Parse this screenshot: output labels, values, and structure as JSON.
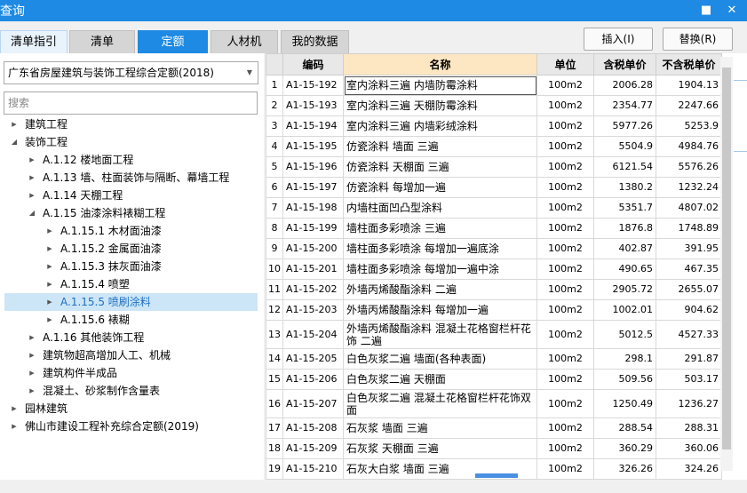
{
  "window": {
    "title": "查询",
    "min_glyph": "■",
    "close_glyph": "✕"
  },
  "tabs": [
    "清单指引",
    "清单",
    "定额",
    "人材机",
    "我的数据"
  ],
  "buttons": {
    "insert": "插入(I)",
    "replace": "替换(R)"
  },
  "combo": {
    "value": "广东省房屋建筑与装饰工程综合定额(2018)"
  },
  "search": {
    "placeholder": "搜索"
  },
  "tree": [
    {
      "label": "建筑工程",
      "state": "collapsed"
    },
    {
      "label": "装饰工程",
      "state": "expanded"
    },
    {
      "label": "A.1.12 楼地面工程",
      "state": "collapsed"
    },
    {
      "label": "A.1.13 墙、柱面装饰与隔断、幕墙工程",
      "state": "collapsed"
    },
    {
      "label": "A.1.14 天棚工程",
      "state": "collapsed"
    },
    {
      "label": "A.1.15 油漆涂料裱糊工程",
      "state": "expanded"
    },
    {
      "label": "A.1.15.1 木材面油漆",
      "state": "collapsed"
    },
    {
      "label": "A.1.15.2 金属面油漆",
      "state": "collapsed"
    },
    {
      "label": "A.1.15.3 抹灰面油漆",
      "state": "collapsed"
    },
    {
      "label": "A.1.15.4 喷塑",
      "state": "collapsed"
    },
    {
      "label": "A.1.15.5 喷刷涂料",
      "state": "collapsed",
      "selected": true
    },
    {
      "label": "A.1.15.6 裱糊",
      "state": "collapsed"
    },
    {
      "label": "A.1.16 其他装饰工程",
      "state": "collapsed"
    },
    {
      "label": "建筑物超高增加人工、机械",
      "state": "collapsed"
    },
    {
      "label": "建筑构件半成品",
      "state": "collapsed"
    },
    {
      "label": "混凝土、砂浆制作含量表",
      "state": "collapsed"
    },
    {
      "label": "园林建筑",
      "state": "collapsed"
    },
    {
      "label": "佛山市建设工程补充综合定额(2019)",
      "state": "collapsed"
    }
  ],
  "grid": {
    "headers": [
      "编码",
      "名称",
      "单位",
      "含税单价",
      "不含税单价"
    ],
    "rows": [
      {
        "n": "1",
        "code": "A1-15-192",
        "name": "室内涂料三遍 内墙防霉涂料",
        "unit": "100m2",
        "tax": "2006.28",
        "notax": "1904.13"
      },
      {
        "n": "2",
        "code": "A1-15-193",
        "name": "室内涂料三遍 天棚防霉涂料",
        "unit": "100m2",
        "tax": "2354.77",
        "notax": "2247.66"
      },
      {
        "n": "3",
        "code": "A1-15-194",
        "name": "室内涂料三遍 内墙彩绒涂料",
        "unit": "100m2",
        "tax": "5977.26",
        "notax": "5253.9"
      },
      {
        "n": "4",
        "code": "A1-15-195",
        "name": "仿瓷涂料 墙面 三遍",
        "unit": "100m2",
        "tax": "5504.9",
        "notax": "4984.76"
      },
      {
        "n": "5",
        "code": "A1-15-196",
        "name": "仿瓷涂料 天棚面 三遍",
        "unit": "100m2",
        "tax": "6121.54",
        "notax": "5576.26"
      },
      {
        "n": "6",
        "code": "A1-15-197",
        "name": "仿瓷涂料 每增加一遍",
        "unit": "100m2",
        "tax": "1380.2",
        "notax": "1232.24"
      },
      {
        "n": "7",
        "code": "A1-15-198",
        "name": "内墙柱面凹凸型涂料",
        "unit": "100m2",
        "tax": "5351.7",
        "notax": "4807.02"
      },
      {
        "n": "8",
        "code": "A1-15-199",
        "name": "墙柱面多彩喷涂 三遍",
        "unit": "100m2",
        "tax": "1876.8",
        "notax": "1748.89"
      },
      {
        "n": "9",
        "code": "A1-15-200",
        "name": "墙柱面多彩喷涂 每增加一遍底涂",
        "unit": "100m2",
        "tax": "402.87",
        "notax": "391.95"
      },
      {
        "n": "10",
        "code": "A1-15-201",
        "name": "墙柱面多彩喷涂 每增加一遍中涂",
        "unit": "100m2",
        "tax": "490.65",
        "notax": "467.35"
      },
      {
        "n": "11",
        "code": "A1-15-202",
        "name": "外墙丙烯酸酯涂料 二遍",
        "unit": "100m2",
        "tax": "2905.72",
        "notax": "2655.07"
      },
      {
        "n": "12",
        "code": "A1-15-203",
        "name": "外墙丙烯酸酯涂料 每增加一遍",
        "unit": "100m2",
        "tax": "1002.01",
        "notax": "904.62"
      },
      {
        "n": "13",
        "code": "A1-15-204",
        "name": "外墙丙烯酸酯涂料 混凝土花格窗栏杆花饰 二遍",
        "unit": "100m2",
        "tax": "5012.5",
        "notax": "4527.33",
        "tall": true
      },
      {
        "n": "14",
        "code": "A1-15-205",
        "name": "白色灰浆二遍 墙面(各种表面)",
        "unit": "100m2",
        "tax": "298.1",
        "notax": "291.87"
      },
      {
        "n": "15",
        "code": "A1-15-206",
        "name": "白色灰浆二遍 天棚面",
        "unit": "100m2",
        "tax": "509.56",
        "notax": "503.17"
      },
      {
        "n": "16",
        "code": "A1-15-207",
        "name": "白色灰浆二遍 混凝土花格窗栏杆花饰双面",
        "unit": "100m2",
        "tax": "1250.49",
        "notax": "1236.27",
        "tall": true
      },
      {
        "n": "17",
        "code": "A1-15-208",
        "name": "石灰浆 墙面 三遍",
        "unit": "100m2",
        "tax": "288.54",
        "notax": "288.31"
      },
      {
        "n": "18",
        "code": "A1-15-209",
        "name": "石灰浆 天棚面 三遍",
        "unit": "100m2",
        "tax": "360.29",
        "notax": "360.06"
      },
      {
        "n": "19",
        "code": "A1-15-210",
        "name": "石灰大白浆 墙面 三遍",
        "unit": "100m2",
        "tax": "326.26",
        "notax": "324.26"
      }
    ]
  }
}
